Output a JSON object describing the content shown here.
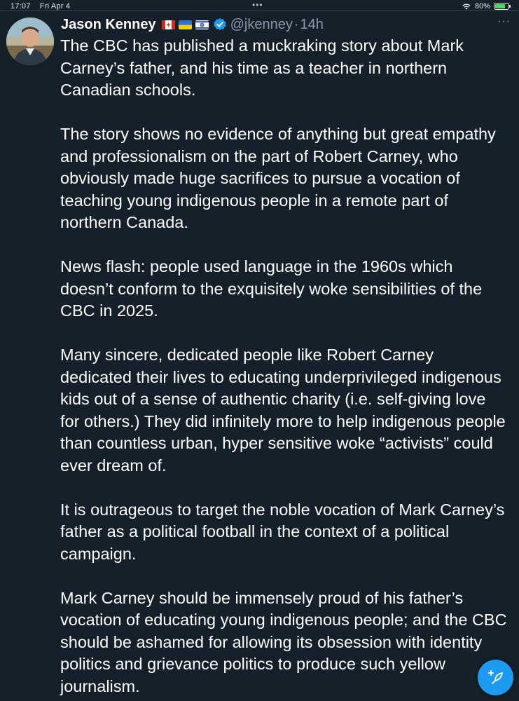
{
  "status_bar": {
    "time": "17:07",
    "date": "Fri Apr 4",
    "multitask_dots": "•••",
    "battery_percent": "80%",
    "battery_level": 0.8,
    "icons": [
      "wifi-icon",
      "battery-charging-icon"
    ]
  },
  "tweet": {
    "author": {
      "display_name": "Jason Kenney",
      "flags": [
        "canada-flag-icon",
        "ukraine-flag-icon",
        "israel-flag-icon"
      ],
      "verified": true,
      "handle": "@jkenney",
      "separator": "·",
      "timestamp": "14h"
    },
    "more_label": "···",
    "paragraphs": [
      "The CBC has published a muckraking story about Mark Carney’s father, and his time as a teacher in northern Canadian schools.",
      "The story shows no evidence of anything but great empathy and professionalism on the part of Robert Carney, who obviously made huge sacrifices to pursue a vocation of teaching young indigenous people in a remote part of northern Canada.",
      "News flash: people used language  in the 1960s which doesn’t conform to the exquisitely woke sensibilities of the CBC in 2025.",
      "Many sincere, dedicated people like Robert Carney dedicated their lives to educating underprivileged indigenous kids out of a sense of authentic charity (i.e. self-giving love for others.) They did infinitely more to help indigenous people than countless urban, hyper sensitive woke “activists” could ever dream of.",
      "It is outrageous to target the noble vocation of Mark Carney’s father as a political football in the context of a political campaign.",
      "Mark Carney should be immensely proud of his father’s vocation of educating young indigenous people; and the CBC should be ashamed for allowing its obsession with identity politics and grievance politics to  produce such yellow journalism."
    ]
  },
  "compose_button": {
    "icon": "compose-feather-plus-icon"
  },
  "colors": {
    "background": "#15202b",
    "text_primary": "#ffffff",
    "text_secondary": "#8b98a5",
    "accent": "#1d9bf0",
    "battery_green": "#4cd964"
  }
}
